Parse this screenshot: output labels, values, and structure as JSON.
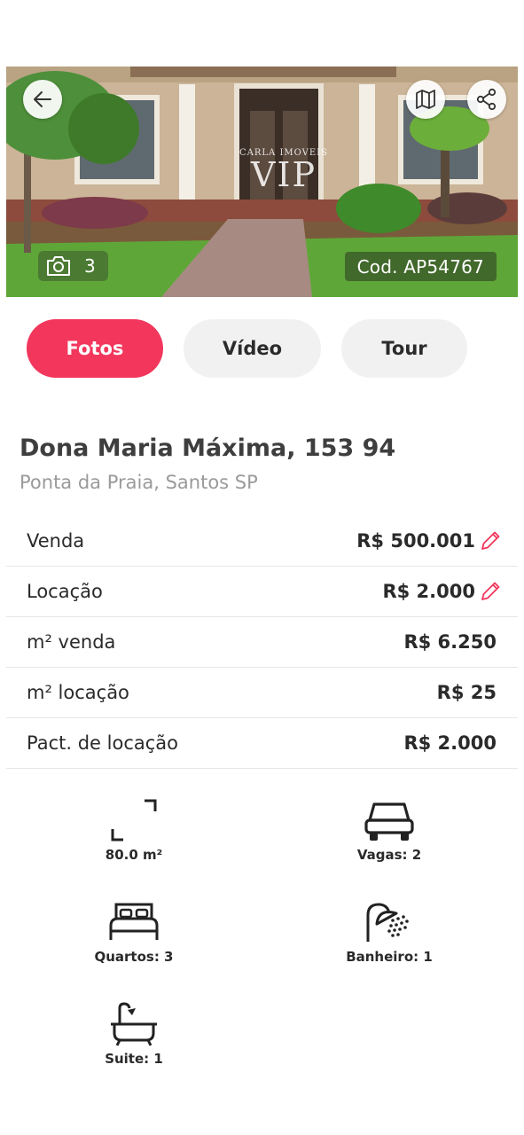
{
  "hero": {
    "photo_count": "3",
    "code": "Cod. AP54767",
    "watermark_top": "CARLA IMOVEIS",
    "watermark_main": "VIP",
    "icons": [
      "arrow-left-icon",
      "map-icon",
      "share-icon",
      "camera-icon"
    ]
  },
  "tabs": [
    {
      "label": "Fotos",
      "active": true
    },
    {
      "label": "Vídeo",
      "active": false
    },
    {
      "label": "Tour",
      "active": false
    }
  ],
  "address": {
    "title": "Dona Maria Máxima, 153 94",
    "subtitle": "Ponta da Praia, Santos SP"
  },
  "prices": [
    {
      "label": "Venda",
      "value": "R$ 500.001",
      "editable": true
    },
    {
      "label": "Locação",
      "value": "R$ 2.000",
      "editable": true
    },
    {
      "label": "m² venda",
      "value": "R$ 6.250",
      "editable": false
    },
    {
      "label": "m² locação",
      "value": "R$ 25",
      "editable": false
    },
    {
      "label": "Pact. de locação",
      "value": "R$ 2.000",
      "editable": false
    }
  ],
  "features": {
    "area": "80.0 m²",
    "vagas": "Vagas: 2",
    "quartos": "Quartos: 3",
    "banheiro": "Banheiro: 1",
    "suite": "Suite: 1"
  },
  "colors": {
    "accent": "#f2365c",
    "tab_inactive": "#f1f1f1",
    "text_dark": "#2a2a2a",
    "text_muted": "#9a9a9a"
  }
}
